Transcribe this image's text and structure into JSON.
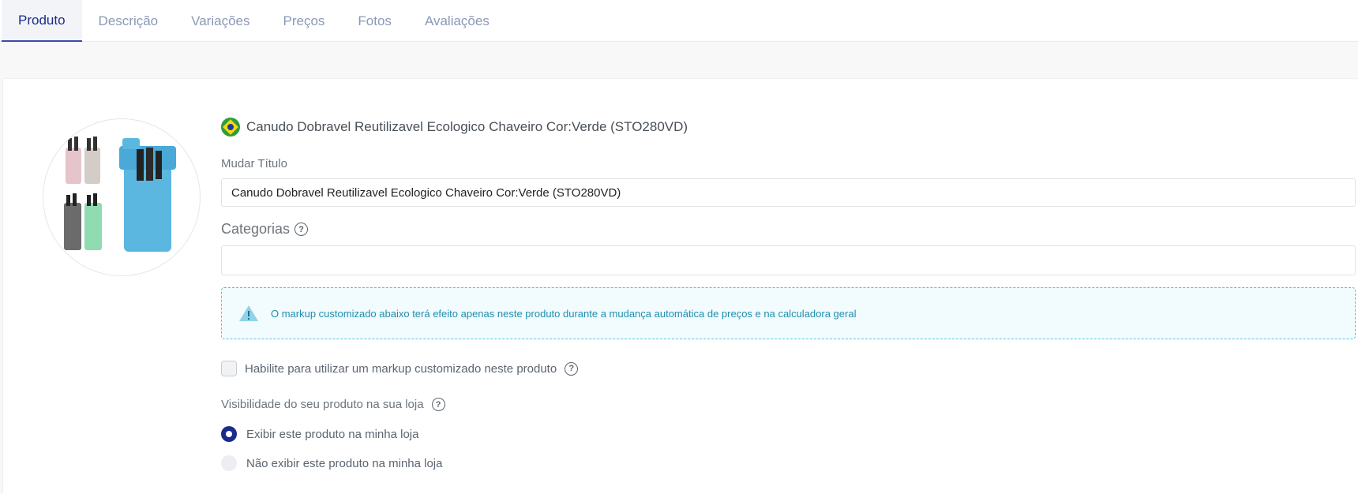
{
  "tabs": [
    {
      "label": "Produto",
      "active": true
    },
    {
      "label": "Descrição",
      "active": false
    },
    {
      "label": "Variações",
      "active": false
    },
    {
      "label": "Preços",
      "active": false
    },
    {
      "label": "Fotos",
      "active": false
    },
    {
      "label": "Avaliações",
      "active": false
    }
  ],
  "product": {
    "flag_icon": "brazil-flag-icon",
    "title": "Canudo Dobravel Reutilizavel Ecologico Chaveiro Cor:Verde (STO280VD)"
  },
  "form": {
    "title_label": "Mudar Título",
    "title_value": "Canudo Dobravel Reutilizavel Ecologico Chaveiro Cor:Verde (STO280VD)",
    "categories_label": "Categorias",
    "categories_value": "",
    "alert_text": "O markup customizado abaixo terá efeito apenas neste produto durante a mudança automática de preços e na calculadora geral",
    "markup_checkbox_label": "Habilite para utilizar um markup customizado neste produto",
    "markup_checked": false,
    "visibility_label": "Visibilidade do seu produto na sua loja",
    "visibility_options": [
      {
        "label": "Exibir este produto na minha loja",
        "checked": true
      },
      {
        "label": "Não exibir este produto na minha loja",
        "checked": false
      }
    ]
  },
  "colors": {
    "accent": "#1a2b8c",
    "alert_text": "#1e8fb0",
    "alert_border": "#5cc2d6"
  }
}
